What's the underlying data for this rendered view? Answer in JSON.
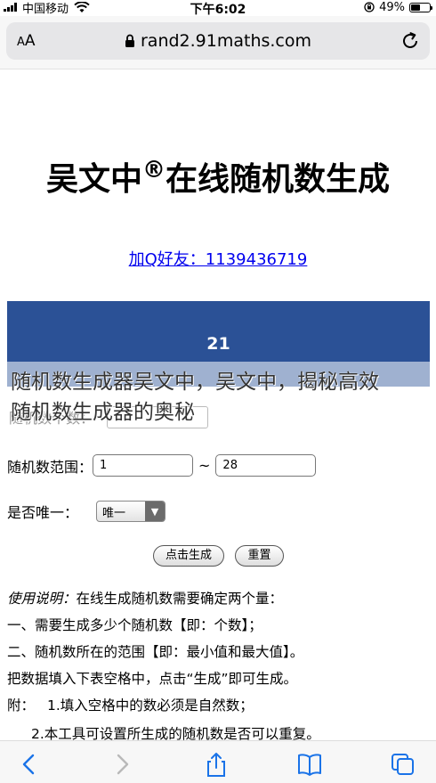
{
  "status_bar": {
    "carrier": "中国移动",
    "time": "下午6:02",
    "battery_percent": "49%",
    "battery_level": 0.49
  },
  "browser": {
    "text_size_label_small": "A",
    "text_size_label_large": "A",
    "url": "rand2.91maths.com"
  },
  "page": {
    "title": "吴文中",
    "title_mark": "®",
    "title_rest": "在线随机数生成",
    "qq_link": "加Q好友：1139436719",
    "result_value": "21",
    "overlay_line1": "随机数生成器吴文中，吴文中，揭秘高效",
    "overlay_line2": "随机数生成器的奥秘",
    "ghost_label": "随机数个数："
  },
  "form": {
    "range_label": "随机数范围：",
    "range_min": "1",
    "range_max": "28",
    "range_separator": "~",
    "unique_label": "是否唯一：",
    "unique_selected": "唯一",
    "generate_button": "点击生成",
    "reset_button": "重置"
  },
  "instructions": {
    "heading": "使用说明：",
    "intro": "在线生成随机数需要确定两个量：",
    "line1": "一、需要生成多少个随机数【即：个数】；",
    "line2": "二、随机数所在的范围【即：最小值和最大值】。",
    "line3": "把数据填入下表空格中，点击“生成”即可生成。",
    "note_prefix": "附：",
    "note1": "1.填入空格中的数必须是自然数；",
    "note2": "2.本工具可设置所生成的随机数是否可以重复。"
  }
}
